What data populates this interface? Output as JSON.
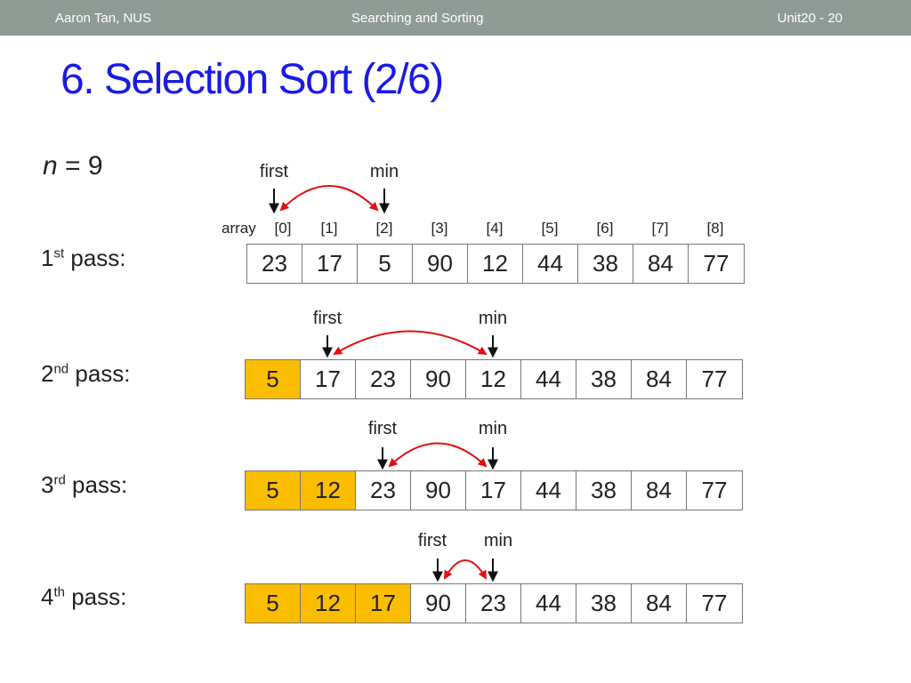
{
  "header": {
    "author": "Aaron Tan,  NUS",
    "topic": "Searching and Sorting",
    "slide_number": "Unit20 - 20"
  },
  "title": "6. Selection Sort (2/6)",
  "n_label": {
    "var": "n",
    "rest": " = 9"
  },
  "array_label": "array",
  "indices": [
    "[0]",
    "[1]",
    "[2]",
    "[3]",
    "[4]",
    "[5]",
    "[6]",
    "[7]",
    "[8]"
  ],
  "colors": {
    "sorted": "#fbbd00",
    "arrow": "#e01010",
    "title": "#1a1ae6",
    "header_bg": "#8f9b95"
  },
  "passes": [
    {
      "ordinal": "1",
      "suffix": "st",
      "label": "pass:",
      "first_label": "first",
      "min_label": "min",
      "first": 0,
      "min": 2,
      "sorted_count": 0,
      "values": [
        "23",
        "17",
        "5",
        "90",
        "12",
        "44",
        "38",
        "84",
        "77"
      ]
    },
    {
      "ordinal": "2",
      "suffix": "nd",
      "label": "pass:",
      "first_label": "first",
      "min_label": "min",
      "first": 1,
      "min": 4,
      "sorted_count": 1,
      "values": [
        "5",
        "17",
        "23",
        "90",
        "12",
        "44",
        "38",
        "84",
        "77"
      ]
    },
    {
      "ordinal": "3",
      "suffix": "rd",
      "label": "pass:",
      "first_label": "first",
      "min_label": "min",
      "first": 2,
      "min": 4,
      "sorted_count": 2,
      "values": [
        "5",
        "12",
        "23",
        "90",
        "17",
        "44",
        "38",
        "84",
        "77"
      ]
    },
    {
      "ordinal": "4",
      "suffix": "th",
      "label": "pass:",
      "first_label": "first",
      "min_label": "min",
      "first": 3,
      "min": 4,
      "sorted_count": 3,
      "values": [
        "5",
        "12",
        "17",
        "90",
        "23",
        "44",
        "38",
        "84",
        "77"
      ]
    }
  ]
}
